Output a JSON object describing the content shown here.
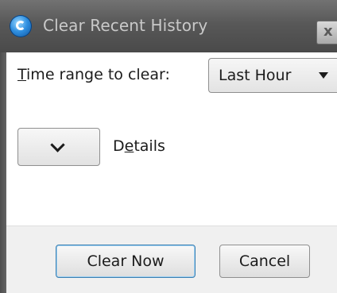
{
  "window": {
    "title": "Clear Recent History",
    "close_symbol": "x",
    "icon": "app-globe-icon"
  },
  "time_range": {
    "label_first_letter": "T",
    "label_rest": "ime range to clear:",
    "selected": "Last Hour"
  },
  "details": {
    "label_before": "D",
    "label_underlined": "e",
    "label_after": "tails",
    "expanded": false
  },
  "buttons": {
    "clear_now": "Clear Now",
    "cancel": "Cancel"
  },
  "colors": {
    "titlebar": "#585858",
    "content": "#ffffff",
    "footer": "#f0f0f0",
    "default_button_border": "#3c7fb1"
  }
}
